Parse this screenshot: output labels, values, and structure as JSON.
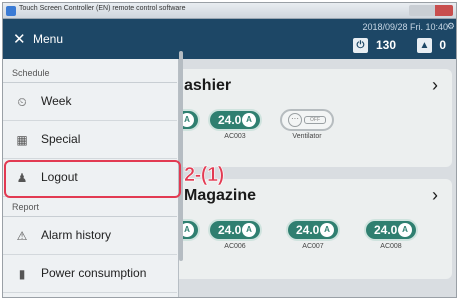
{
  "window": {
    "title": "Touch Screen Controller (EN)  remote control software"
  },
  "header": {
    "datetime": "2018/09/28 Fri. 10:40",
    "power_count": "130",
    "alarm_count": "0",
    "power_icon": "power-icon",
    "alarm_icon": "alarm-icon"
  },
  "menu": {
    "close_symbol": "✕",
    "title": "Menu",
    "sections": [
      {
        "label": "Schedule",
        "items": [
          {
            "label": "Week",
            "icon": "week-icon"
          },
          {
            "label": "Special",
            "icon": "special-icon"
          },
          {
            "label": "Logout",
            "icon": "person-icon"
          }
        ]
      },
      {
        "label": "Report",
        "items": [
          {
            "label": "Alarm history",
            "icon": "alarm-history-icon"
          },
          {
            "label": "Power consumption",
            "icon": "power-consumption-icon"
          }
        ]
      }
    ]
  },
  "groups": [
    {
      "title": "ashier",
      "units": [
        {
          "name": "",
          "temp": "",
          "type": "ac"
        },
        {
          "name": "AC003",
          "temp": "24.0",
          "type": "ac"
        },
        {
          "name": "Ventilator",
          "temp": "",
          "off_label": "OFF",
          "type": "vent"
        }
      ]
    },
    {
      "title": "Magazine",
      "units": [
        {
          "name": "",
          "temp": "",
          "type": "ac"
        },
        {
          "name": "AC006",
          "temp": "24.0",
          "type": "ac"
        },
        {
          "name": "AC007",
          "temp": "24.0",
          "type": "ac"
        },
        {
          "name": "AC008",
          "temp": "24.0",
          "type": "ac"
        }
      ]
    }
  ],
  "annotation": {
    "step_label": "2-(1)"
  },
  "colors": {
    "header_bg": "#1d4766",
    "unit_green": "#2f7f70",
    "highlight_red": "#e23a52",
    "menu_bg": "#eef1f3"
  }
}
